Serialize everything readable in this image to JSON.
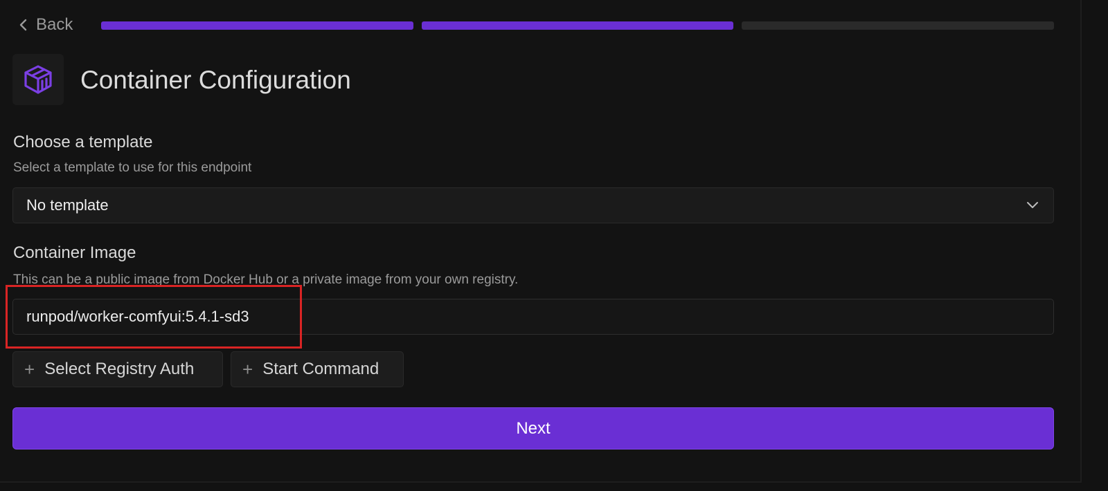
{
  "nav": {
    "back_label": "Back",
    "progress_steps": [
      {
        "state": "complete"
      },
      {
        "state": "complete"
      },
      {
        "state": "pending"
      }
    ]
  },
  "header": {
    "icon": "container-icon",
    "title": "Container Configuration"
  },
  "template_section": {
    "label": "Choose a template",
    "description": "Select a template to use for this endpoint",
    "selected": "No template"
  },
  "image_section": {
    "label": "Container Image",
    "description": "This can be a public image from Docker Hub or a private image from your own registry.",
    "value": "runpod/worker-comfyui:5.4.1-sd3"
  },
  "actions": {
    "registry_auth_label": "Select Registry Auth",
    "start_command_label": "Start Command",
    "plus_glyph": "+",
    "next_label": "Next"
  },
  "colors": {
    "accent": "#6a2fd4",
    "background": "#131313",
    "highlight": "#d92424"
  }
}
